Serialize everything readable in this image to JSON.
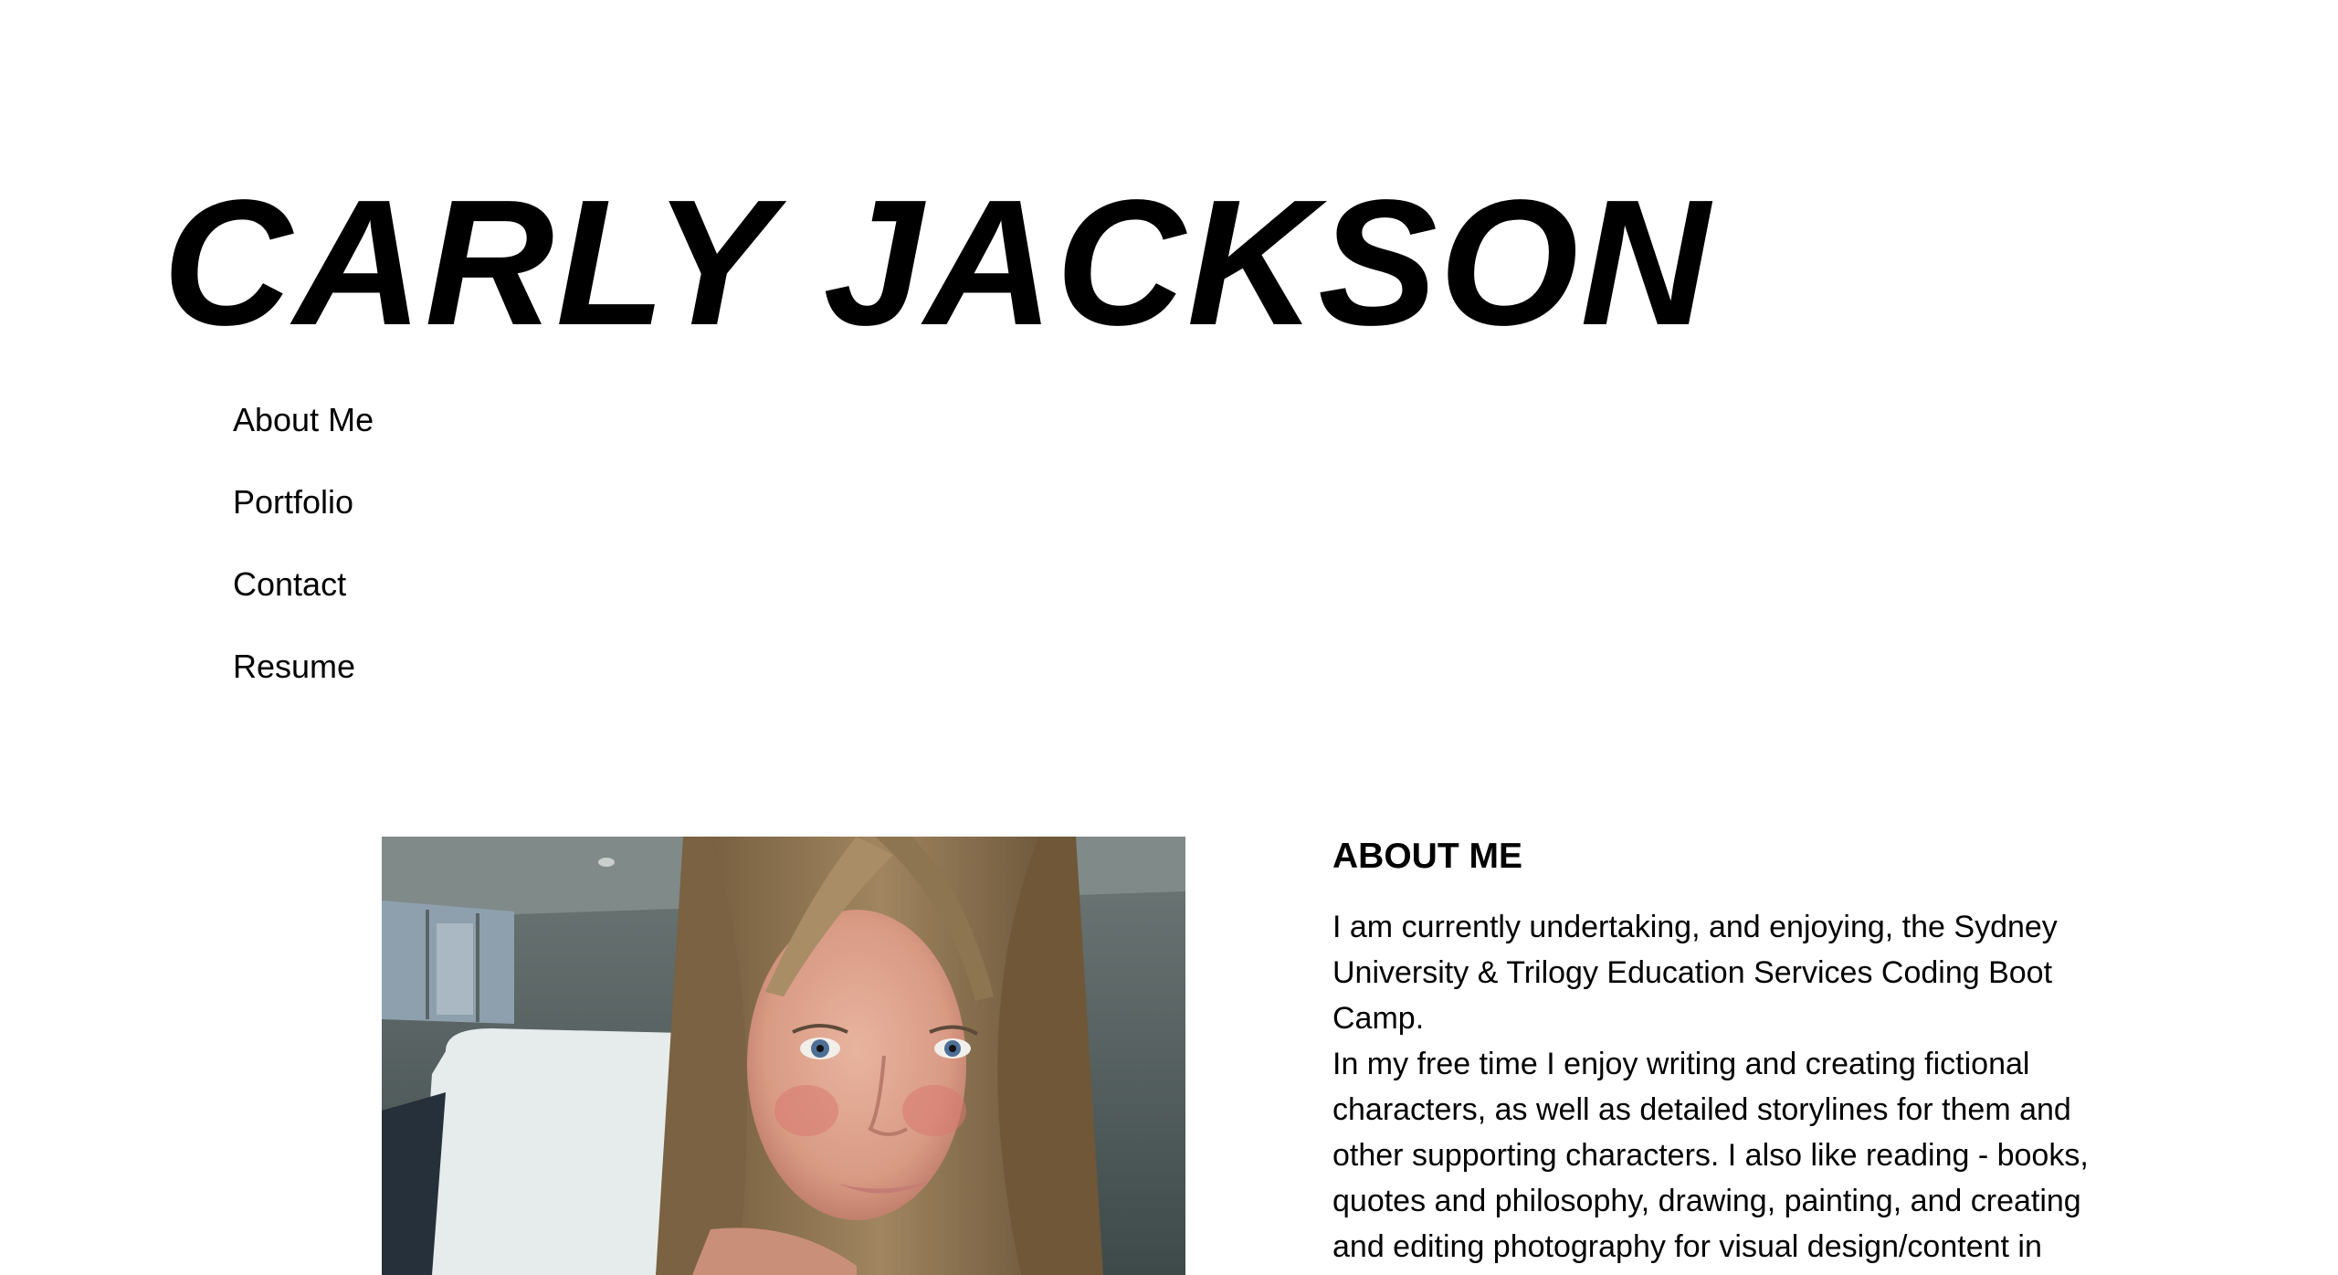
{
  "header": {
    "title": "CARLY JACKSON"
  },
  "nav": {
    "items": [
      {
        "label": "About Me"
      },
      {
        "label": "Portfolio"
      },
      {
        "label": "Contact"
      },
      {
        "label": "Resume"
      }
    ]
  },
  "about": {
    "heading": "ABOUT ME",
    "paragraphs": [
      "I am currently undertaking, and enjoying, the Sydney University & Trilogy Education Services Coding Boot Camp.",
      "In my free time I enjoy writing and creating fictional characters, as well as detailed storylines for them and other supporting characters. I also like reading - books, quotes and philosophy, drawing, painting, and creating and editing photography for visual design/content in"
    ]
  },
  "colors": {
    "text": "#000000",
    "background": "#ffffff"
  }
}
